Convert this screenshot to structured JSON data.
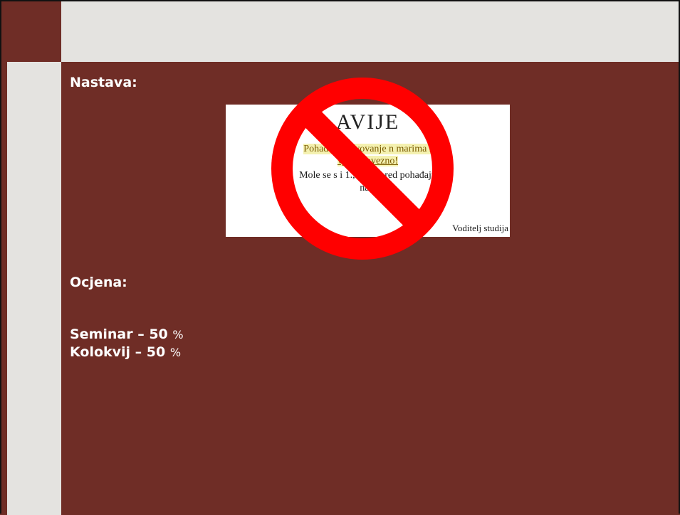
{
  "slide": {
    "heading_teaching": "Nastava:",
    "heading_grade": "Ocjena:",
    "grade_items": [
      {
        "label": "Seminar – 50",
        "unit": "%"
      },
      {
        "label": "Kolokvij – 50",
        "unit": "%"
      }
    ]
  },
  "notice": {
    "title": "AVIJE",
    "line1": "Pohađanj          ustvovanje n          marima i",
    "line2": "vježb        bavezno!",
    "line3": "Mole se s      i 1., 2. i        da red         pohađaju",
    "line4": "nast",
    "signature": "Voditelj studija"
  },
  "overlay": {
    "icon": "prohibited-icon",
    "color": "#ff0000"
  }
}
